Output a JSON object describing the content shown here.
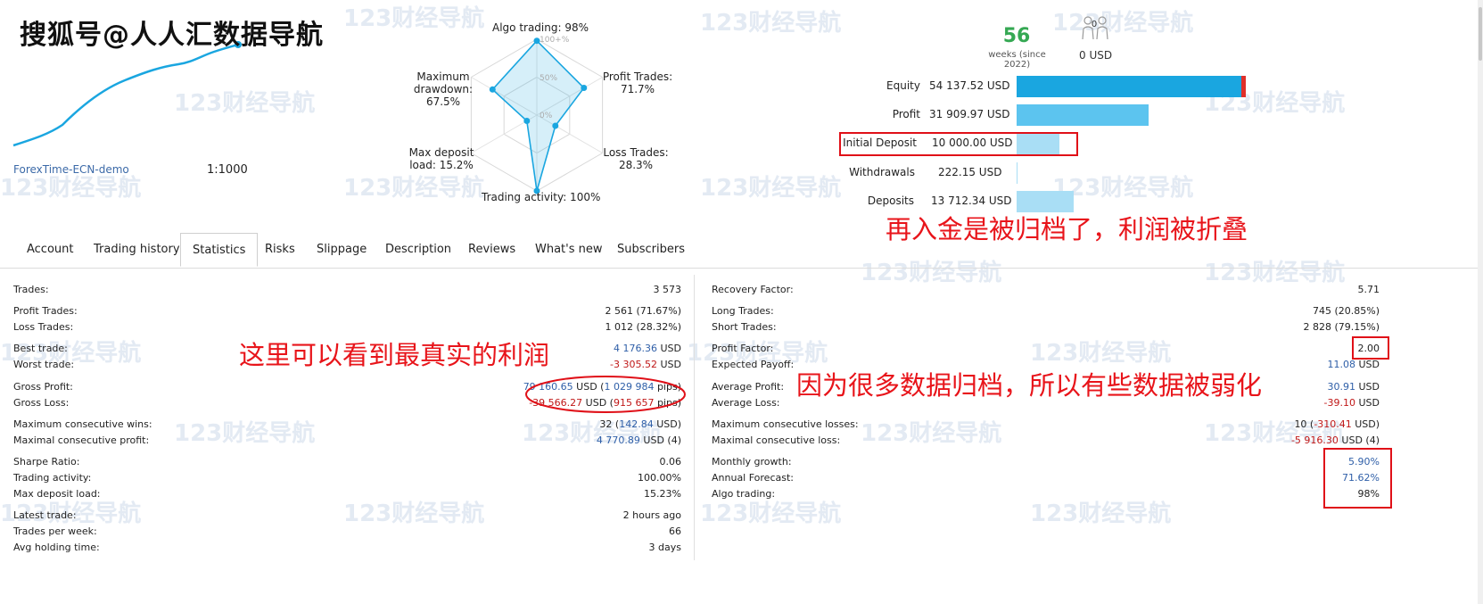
{
  "overlay_title": "搜狐号@人人汇数据导航",
  "watermark_text": "123财经导航",
  "account": {
    "broker": "ForexTime-ECN-demo",
    "leverage": "1:1000"
  },
  "radar": {
    "algo": "Algo trading: 98%",
    "profit_trades_1": "Profit Trades:",
    "profit_trades_2": "71.7%",
    "loss_trades_1": "Loss Trades:",
    "loss_trades_2": "28.3%",
    "activity": "Trading activity: 100%",
    "deposit_load_1": "Max deposit",
    "deposit_load_2": "load: 15.2%",
    "drawdown_1": "Maximum",
    "drawdown_2": "drawdown:",
    "drawdown_3": "67.5%",
    "scale_100": "100+%",
    "scale_50": "50%",
    "scale_0": "0%",
    "values": {
      "algo": 0.98,
      "profit_trades": 0.717,
      "loss_trades": 0.283,
      "activity": 1.0,
      "deposit_load": 0.152,
      "drawdown": 0.675
    }
  },
  "summary": {
    "weeks": "56",
    "weeks_label": "weeks (since 2022)",
    "subscribers": "0",
    "subscribers_usd": "0 USD"
  },
  "financials": [
    {
      "label": "Equity",
      "value": "54 137.52 USD",
      "fraction": 0.95,
      "color": "#1aa6e0",
      "marker": "#e0302a"
    },
    {
      "label": "Profit",
      "value": "31 909.97 USD",
      "fraction": 0.56,
      "color": "#5cc4ef"
    },
    {
      "label": "Initial Deposit",
      "value": "10 000.00 USD",
      "fraction": 0.18,
      "color": "#a9def5"
    },
    {
      "label": "Withdrawals",
      "value": "222.15 USD",
      "fraction": 0.004,
      "color": "#a9def5"
    },
    {
      "label": "Deposits",
      "value": "13 712.34 USD",
      "fraction": 0.24,
      "color": "#a9def5"
    }
  ],
  "tabs": [
    "Account",
    "Trading history",
    "Statistics",
    "Risks",
    "Slippage",
    "Description",
    "Reviews",
    "What's new",
    "Subscribers"
  ],
  "active_tab": "Statistics",
  "stats_left": {
    "trades_k": "Trades:",
    "trades_v": "3 573",
    "profit_trades_k": "Profit Trades:",
    "profit_trades_v": "2 561 (71.67%)",
    "loss_trades_k": "Loss Trades:",
    "loss_trades_v": "1 012 (28.32%)",
    "best_trade_k": "Best trade:",
    "best_trade_v": "4 176.36",
    "best_trade_u": "USD",
    "worst_trade_k": "Worst trade:",
    "worst_trade_v": "-3 305.52",
    "worst_trade_u": "USD",
    "gross_profit_k": "Gross Profit:",
    "gross_profit_v": "79 160.65",
    "gross_profit_u": "USD (",
    "gross_profit_p": "1 029 984",
    "gross_profit_e": "pips)",
    "gross_loss_k": "Gross Loss:",
    "gross_loss_v": "-39 566.27",
    "gross_loss_u": "USD (",
    "gross_loss_p": "915 657",
    "gross_loss_e": "pips)",
    "max_wins_k": "Maximum consecutive wins:",
    "max_wins_v": "32 (",
    "max_wins_a": "142.84",
    "max_wins_e": "USD)",
    "max_profit_k": "Maximal consecutive profit:",
    "max_profit_v": "4 770.89",
    "max_profit_e": "USD (4)",
    "sharpe_k": "Sharpe Ratio:",
    "sharpe_v": "0.06",
    "activity_k": "Trading activity:",
    "activity_v": "100.00%",
    "deposit_load_k": "Max deposit load:",
    "deposit_load_v": "15.23%",
    "latest_k": "Latest trade:",
    "latest_v": "2 hours ago",
    "per_week_k": "Trades per week:",
    "per_week_v": "66",
    "holding_k": "Avg holding time:",
    "holding_v": "3 days"
  },
  "stats_right": {
    "recovery_k": "Recovery Factor:",
    "recovery_v": "5.71",
    "long_k": "Long Trades:",
    "long_v": "745 (20.85%)",
    "short_k": "Short Trades:",
    "short_v": "2 828 (79.15%)",
    "pf_k": "Profit Factor:",
    "pf_v": "2.00",
    "payoff_k": "Expected Payoff:",
    "payoff_v": "11.08",
    "payoff_u": "USD",
    "avg_profit_k": "Average Profit:",
    "avg_profit_v": "30.91",
    "avg_profit_u": "USD",
    "avg_loss_k": "Average Loss:",
    "avg_loss_v": "-39.10",
    "avg_loss_u": "USD",
    "max_losses_k": "Maximum consecutive losses:",
    "max_losses_v": "10 (",
    "max_losses_a": "-310.41",
    "max_losses_e": "USD)",
    "max_loss_k": "Maximal consecutive loss:",
    "max_loss_v": "-5 916.30",
    "max_loss_e": "USD (4)",
    "monthly_k": "Monthly growth:",
    "monthly_v": "5.90%",
    "annual_k": "Annual Forecast:",
    "annual_v": "71.62%",
    "algo_k": "Algo trading:",
    "algo_v": "98%"
  },
  "annotations": {
    "deposit_note": "再入金是被归档了，利润被折叠",
    "profit_note": "这里可以看到最真实的利润",
    "archive_note": "因为很多数据归档，所以有些数据被弱化"
  },
  "colors": {
    "accent": "#1aa6e0",
    "positive": "#2f5fa8",
    "negative": "#c01818",
    "annotation": "#e8141a",
    "weeks": "#35a853"
  }
}
